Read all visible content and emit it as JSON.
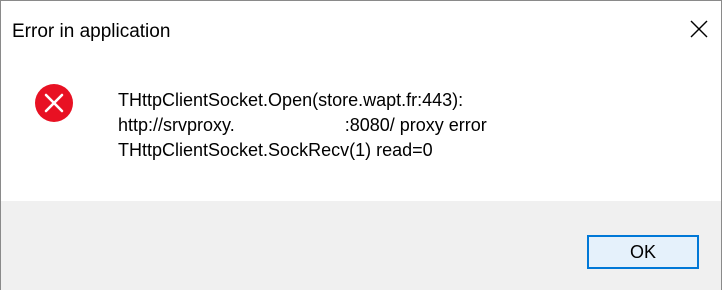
{
  "window": {
    "title": "Error in application",
    "close_icon": "close-icon"
  },
  "message": {
    "icon": "error-icon",
    "icon_color": "#e81123",
    "lines": [
      "THttpClientSocket.Open(store.wapt.fr:443):",
      "http://srvproxy.                      :8080/ proxy error",
      "THttpClientSocket.SockRecv(1) read=0"
    ]
  },
  "footer": {
    "ok_label": "OK",
    "accent_color": "#0078d7"
  }
}
